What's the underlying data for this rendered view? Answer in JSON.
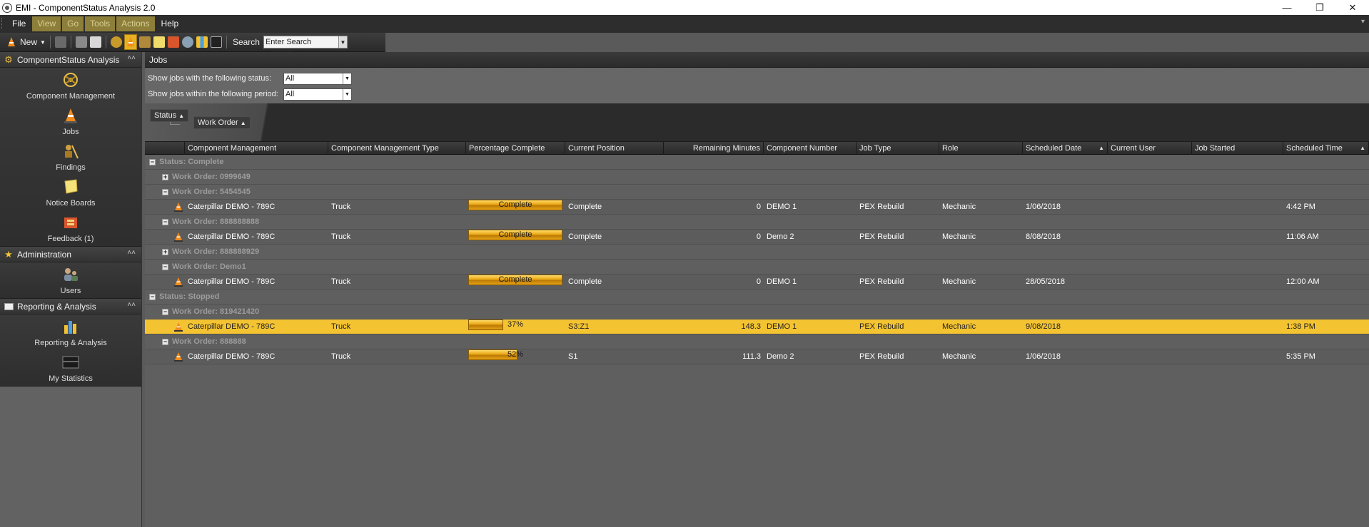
{
  "window": {
    "title": "EMI - ComponentStatus Analysis 2.0"
  },
  "menu": [
    "File",
    "View",
    "Go",
    "Tools",
    "Actions",
    "Help"
  ],
  "toolbar": {
    "new_label": "New",
    "search_label": "Search",
    "search_value": "Enter Search Criteria"
  },
  "sidebar": {
    "sections": [
      {
        "title": "ComponentStatus Analysis",
        "items": [
          "Component Management",
          "Jobs",
          "Findings",
          "Notice Boards",
          "Feedback (1)"
        ]
      },
      {
        "title": "Administration",
        "items": [
          "Users"
        ]
      },
      {
        "title": "Reporting & Analysis",
        "items": [
          "Reporting & Analysis",
          "My Statistics"
        ]
      }
    ]
  },
  "main": {
    "title": "Jobs",
    "filters": [
      {
        "label": "Show jobs with the following status:",
        "value": "All"
      },
      {
        "label": "Show jobs within the following period:",
        "value": "All"
      }
    ],
    "group_chips": [
      "Status",
      "Work Order"
    ],
    "columns": [
      "Component Management",
      "Component Management Type",
      "Percentage Complete",
      "Current Position",
      "Remaining Minutes",
      "Component Number",
      "Job Type",
      "Role",
      "Scheduled Date",
      "Current User",
      "Job Started",
      "Scheduled Time"
    ],
    "rows": [
      {
        "kind": "status",
        "label": "Status: Complete",
        "exp": "−"
      },
      {
        "kind": "wo",
        "label": "Work Order: 0999649",
        "exp": "+"
      },
      {
        "kind": "wo",
        "label": "Work Order: 5454545",
        "exp": "−"
      },
      {
        "kind": "data",
        "cm": "Caterpillar DEMO - 789C",
        "type": "Truck",
        "pct_text": "Complete",
        "pct": 100,
        "pos": "Complete",
        "rem": "0",
        "num": "DEMO 1",
        "job": "PEX Rebuild",
        "role": "Mechanic",
        "date": "1/06/2018",
        "user": "",
        "started": "",
        "time": "4:42 PM"
      },
      {
        "kind": "wo",
        "label": "Work Order: 888888888",
        "exp": "−"
      },
      {
        "kind": "data",
        "cm": "Caterpillar DEMO - 789C",
        "type": "Truck",
        "pct_text": "Complete",
        "pct": 100,
        "pos": "Complete",
        "rem": "0",
        "num": "Demo 2",
        "job": "PEX Rebuild",
        "role": "Mechanic",
        "date": "8/08/2018",
        "user": "",
        "started": "",
        "time": "11:06 AM"
      },
      {
        "kind": "wo",
        "label": "Work Order: 888888929",
        "exp": "+"
      },
      {
        "kind": "wo",
        "label": "Work Order: Demo1",
        "exp": "−"
      },
      {
        "kind": "data",
        "cm": "Caterpillar DEMO - 789C",
        "type": "Truck",
        "pct_text": "Complete",
        "pct": 100,
        "pos": "Complete",
        "rem": "0",
        "num": "DEMO 1",
        "job": "PEX Rebuild",
        "role": "Mechanic",
        "date": "28/05/2018",
        "user": "",
        "started": "",
        "time": "12:00 AM"
      },
      {
        "kind": "status",
        "label": "Status: Stopped",
        "exp": "−"
      },
      {
        "kind": "wo",
        "label": "Work Order: 819421420",
        "exp": "−"
      },
      {
        "kind": "data",
        "selected": true,
        "cm": "Caterpillar DEMO - 789C",
        "type": "Truck",
        "pct_text": "37%",
        "pct": 37,
        "pos": "S3:Z1",
        "rem": "148.3",
        "num": "DEMO 1",
        "job": "PEX Rebuild",
        "role": "Mechanic",
        "date": "9/08/2018",
        "user": "",
        "started": "",
        "time": "1:38 PM"
      },
      {
        "kind": "wo",
        "label": "Work Order: 888888",
        "exp": "−"
      },
      {
        "kind": "data",
        "cm": "Caterpillar DEMO - 789C",
        "type": "Truck",
        "pct_text": "52%",
        "pct": 52,
        "pos": "S1",
        "rem": "111.3",
        "num": "Demo 2",
        "job": "PEX Rebuild",
        "role": "Mechanic",
        "date": "1/06/2018",
        "user": "",
        "started": "",
        "time": "5:35 PM"
      }
    ]
  },
  "colors": {
    "accent": "#f4c331",
    "bar": "#e8a411"
  }
}
